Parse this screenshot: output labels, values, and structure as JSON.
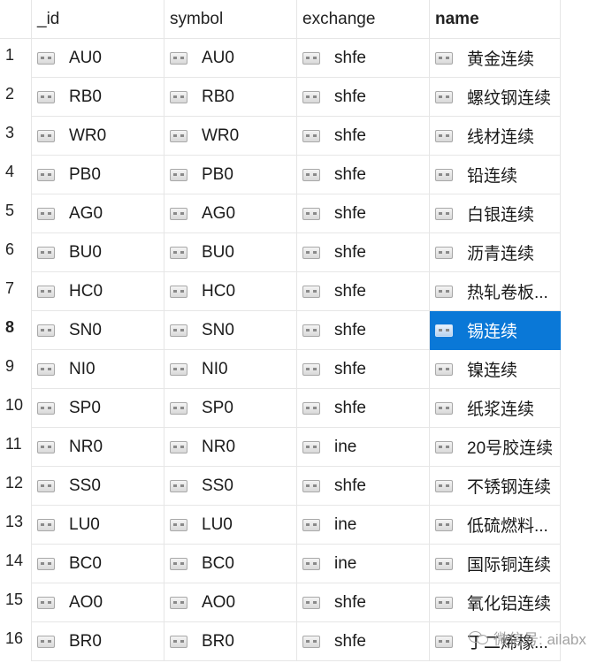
{
  "columns": [
    {
      "label": "_id"
    },
    {
      "label": "symbol"
    },
    {
      "label": "exchange"
    },
    {
      "label": "name"
    }
  ],
  "selected_row": 8,
  "selected_column": "name",
  "rows": [
    {
      "num": "1",
      "id": "AU0",
      "symbol": "AU0",
      "exchange": "shfe",
      "name": "黄金连续"
    },
    {
      "num": "2",
      "id": "RB0",
      "symbol": "RB0",
      "exchange": "shfe",
      "name": "螺纹钢连续"
    },
    {
      "num": "3",
      "id": "WR0",
      "symbol": "WR0",
      "exchange": "shfe",
      "name": "线材连续"
    },
    {
      "num": "4",
      "id": "PB0",
      "symbol": "PB0",
      "exchange": "shfe",
      "name": "铅连续"
    },
    {
      "num": "5",
      "id": "AG0",
      "symbol": "AG0",
      "exchange": "shfe",
      "name": "白银连续"
    },
    {
      "num": "6",
      "id": "BU0",
      "symbol": "BU0",
      "exchange": "shfe",
      "name": "沥青连续"
    },
    {
      "num": "7",
      "id": "HC0",
      "symbol": "HC0",
      "exchange": "shfe",
      "name": "热轧卷板..."
    },
    {
      "num": "8",
      "id": "SN0",
      "symbol": "SN0",
      "exchange": "shfe",
      "name": "锡连续"
    },
    {
      "num": "9",
      "id": "NI0",
      "symbol": "NI0",
      "exchange": "shfe",
      "name": "镍连续"
    },
    {
      "num": "10",
      "id": "SP0",
      "symbol": "SP0",
      "exchange": "shfe",
      "name": "纸浆连续"
    },
    {
      "num": "11",
      "id": "NR0",
      "symbol": "NR0",
      "exchange": "ine",
      "name": "20号胶连续"
    },
    {
      "num": "12",
      "id": "SS0",
      "symbol": "SS0",
      "exchange": "shfe",
      "name": "不锈钢连续"
    },
    {
      "num": "13",
      "id": "LU0",
      "symbol": "LU0",
      "exchange": "ine",
      "name": "低硫燃料..."
    },
    {
      "num": "14",
      "id": "BC0",
      "symbol": "BC0",
      "exchange": "ine",
      "name": "国际铜连续"
    },
    {
      "num": "15",
      "id": "AO0",
      "symbol": "AO0",
      "exchange": "shfe",
      "name": "氧化铝连续"
    },
    {
      "num": "16",
      "id": "BR0",
      "symbol": "BR0",
      "exchange": "shfe",
      "name": "丁二烯橡..."
    }
  ],
  "cell_icon": "binary-field-icon",
  "colors": {
    "selection": "#0a78d7",
    "grid_line": "#e6e6e6"
  },
  "watermark": {
    "text": "微信号: ailabx",
    "icon": "wechat-icon"
  }
}
